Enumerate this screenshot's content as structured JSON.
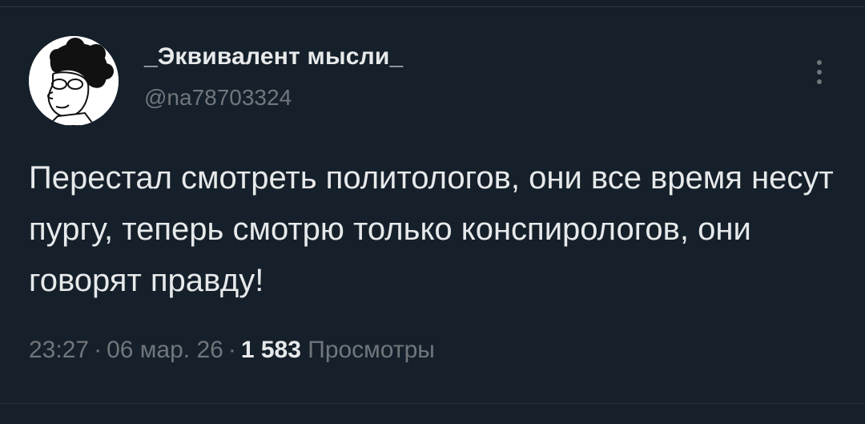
{
  "colors": {
    "background": "#15202b",
    "primary_text": "#e7e9ea",
    "secondary_text": "#71767b",
    "divider": "#2f3336"
  },
  "author": {
    "display_name": "_Эквивалент мысли_",
    "handle": "@na78703324",
    "avatar_icon": "avatar-cartoon-character"
  },
  "more_icon": "vertical-ellipsis-icon",
  "tweet": {
    "text": "Перестал смотреть политологов, они все время несут пургу, теперь смотрю только конспирологов, они говорят правду!"
  },
  "meta": {
    "time": "23:27",
    "separator": "·",
    "date": "06 мар. 26",
    "views_count": "1 583",
    "views_label": "Просмотры"
  }
}
